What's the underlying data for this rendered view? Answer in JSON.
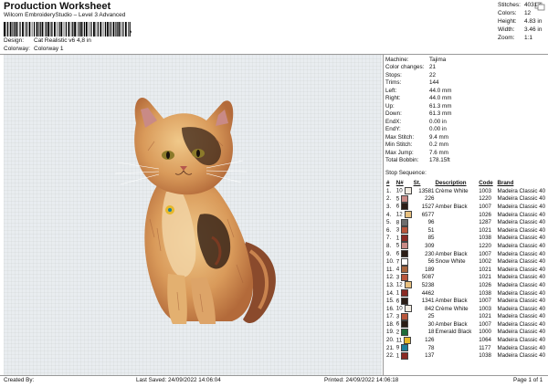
{
  "header": {
    "title": "Production Worksheet",
    "subtitle": "Wilcom EmbroideryStudio – Level 3 Advanced",
    "barcode_suffix": ",",
    "design_label": "Design:",
    "design_value": "Cat Realistic v6 4,8 in",
    "colorway_label": "Colorway:",
    "colorway_value": "Colorway 1"
  },
  "summary": [
    {
      "label": "Stitches:",
      "value": "40313"
    },
    {
      "label": "Colors:",
      "value": "12"
    },
    {
      "label": "Height:",
      "value": "4.83 in"
    },
    {
      "label": "Width:",
      "value": "3.46 in"
    },
    {
      "label": "Zoom:",
      "value": "1:1"
    }
  ],
  "machine_info": [
    {
      "label": "Machine:",
      "value": "Tajima"
    },
    {
      "label": "Color changes:",
      "value": "21"
    },
    {
      "label": "Stops:",
      "value": "22"
    },
    {
      "label": "Trims:",
      "value": "144"
    },
    {
      "label": "Left:",
      "value": "44.0 mm"
    },
    {
      "label": "Right:",
      "value": "44.0 mm"
    },
    {
      "label": "Up:",
      "value": "61.3 mm"
    },
    {
      "label": "Down:",
      "value": "61.3 mm"
    },
    {
      "label": "EndX:",
      "value": "0.00 in"
    },
    {
      "label": "EndY:",
      "value": "0.00 in"
    },
    {
      "label": "Max Stitch:",
      "value": "9.4 mm"
    },
    {
      "label": "Min Stitch:",
      "value": "0.2 mm"
    },
    {
      "label": "Max Jump:",
      "value": "7.6 mm"
    },
    {
      "label": "Total Bobbin:",
      "value": "178.15ft"
    }
  ],
  "stop_sequence": {
    "label": "Stop Sequence:",
    "columns": [
      "#",
      "N#",
      "St.",
      "Description",
      "Code",
      "Brand"
    ],
    "rows": [
      {
        "n": "1.",
        "nn": "10",
        "color": "#f2ece2",
        "st": "13581",
        "desc": "Crème White",
        "code": "1003",
        "brand": "Madeira Classic 40"
      },
      {
        "n": "2.",
        "nn": "5",
        "color": "#c98a86",
        "st": "226",
        "desc": "",
        "code": "1220",
        "brand": "Madeira Classic 40"
      },
      {
        "n": "3.",
        "nn": "6",
        "color": "#2b1d16",
        "st": "1527",
        "desc": "Amber Black",
        "code": "1007",
        "brand": "Madeira Classic 40"
      },
      {
        "n": "4.",
        "nn": "12",
        "color": "#e8c07e",
        "st": "6577",
        "desc": "",
        "code": "1026",
        "brand": "Madeira Classic 40"
      },
      {
        "n": "5.",
        "nn": "8",
        "color": "#6e6e6e",
        "st": "96",
        "desc": "",
        "code": "1287",
        "brand": "Madeira Classic 40"
      },
      {
        "n": "6.",
        "nn": "3",
        "color": "#b8563c",
        "st": "51",
        "desc": "",
        "code": "1021",
        "brand": "Madeira Classic 40"
      },
      {
        "n": "7.",
        "nn": "1",
        "color": "#8a2a24",
        "st": "85",
        "desc": "",
        "code": "1038",
        "brand": "Madeira Classic 40"
      },
      {
        "n": "8.",
        "nn": "5",
        "color": "#c98a86",
        "st": "309",
        "desc": "",
        "code": "1220",
        "brand": "Madeira Classic 40"
      },
      {
        "n": "9.",
        "nn": "6",
        "color": "#2b1d16",
        "st": "230",
        "desc": "Amber Black",
        "code": "1007",
        "brand": "Madeira Classic 40"
      },
      {
        "n": "10.",
        "nn": "7",
        "color": "#ffffff",
        "st": "56",
        "desc": "Snow White",
        "code": "1002",
        "brand": "Madeira Classic 40"
      },
      {
        "n": "11.",
        "nn": "4",
        "color": "#a8663e",
        "st": "189",
        "desc": "",
        "code": "1021",
        "brand": "Madeira Classic 40"
      },
      {
        "n": "12.",
        "nn": "3",
        "color": "#b8563c",
        "st": "5087",
        "desc": "",
        "code": "1021",
        "brand": "Madeira Classic 40"
      },
      {
        "n": "13.",
        "nn": "12",
        "color": "#e8c07e",
        "st": "5238",
        "desc": "",
        "code": "1026",
        "brand": "Madeira Classic 40"
      },
      {
        "n": "14.",
        "nn": "1",
        "color": "#8a2a24",
        "st": "4462",
        "desc": "",
        "code": "1038",
        "brand": "Madeira Classic 40"
      },
      {
        "n": "15.",
        "nn": "6",
        "color": "#2b1d16",
        "st": "1341",
        "desc": "Amber Black",
        "code": "1007",
        "brand": "Madeira Classic 40"
      },
      {
        "n": "16.",
        "nn": "10",
        "color": "#f2ece2",
        "st": "842",
        "desc": "Crème White",
        "code": "1003",
        "brand": "Madeira Classic 40"
      },
      {
        "n": "17.",
        "nn": "3",
        "color": "#b8563c",
        "st": "25",
        "desc": "",
        "code": "1021",
        "brand": "Madeira Classic 40"
      },
      {
        "n": "18.",
        "nn": "6",
        "color": "#2b1d16",
        "st": "30",
        "desc": "Amber Black",
        "code": "1007",
        "brand": "Madeira Classic 40"
      },
      {
        "n": "19.",
        "nn": "2",
        "color": "#1e6b3a",
        "st": "18",
        "desc": "Emerald Black",
        "code": "1000",
        "brand": "Madeira Classic 40"
      },
      {
        "n": "20.",
        "nn": "11",
        "color": "#e6b82a",
        "st": "126",
        "desc": "",
        "code": "1064",
        "brand": "Madeira Classic 40"
      },
      {
        "n": "21.",
        "nn": "9",
        "color": "#1f7f9a",
        "st": "78",
        "desc": "",
        "code": "1177",
        "brand": "Madeira Classic 40"
      },
      {
        "n": "22.",
        "nn": "1",
        "color": "#8a2a24",
        "st": "137",
        "desc": "",
        "code": "1038",
        "brand": "Madeira Classic 40"
      }
    ]
  },
  "footer": {
    "created": "Created By:",
    "saved": "Last Saved: 24/09/2022 14:06:04",
    "printed": "Printed: 24/09/2022 14:06:18",
    "page": "Page 1 of 1"
  },
  "icons": {
    "corner": "copy-icon",
    "design": "cat-embroidery-icon"
  }
}
